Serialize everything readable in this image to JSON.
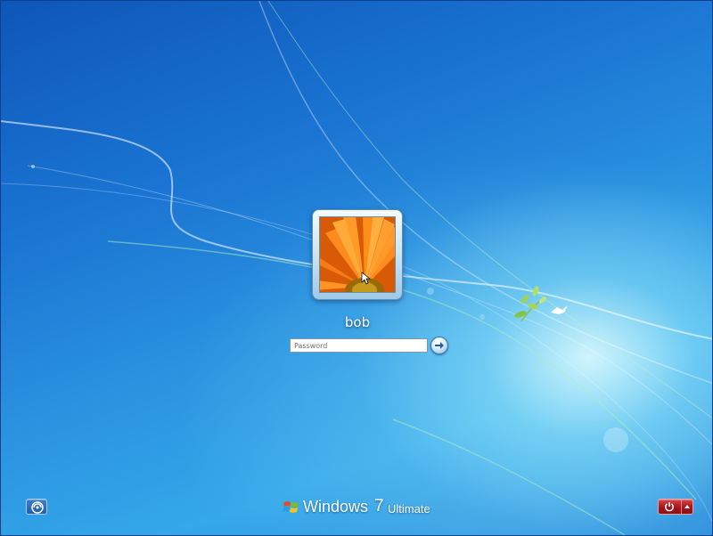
{
  "login": {
    "username": "bob",
    "password_placeholder": "Password",
    "avatar_icon": "flower-picture",
    "submit_icon": "arrow-right-icon"
  },
  "footer": {
    "ease_of_access_icon": "ease-of-access-icon",
    "brand_name": "Windows",
    "brand_version": "7",
    "brand_edition": "Ultimate",
    "shutdown_icon": "power-icon",
    "shutdown_options_icon": "triangle-up-icon"
  },
  "colors": {
    "background": "#1a74d2",
    "shutdown_red": "#c0282e",
    "text": "#ffffff"
  }
}
